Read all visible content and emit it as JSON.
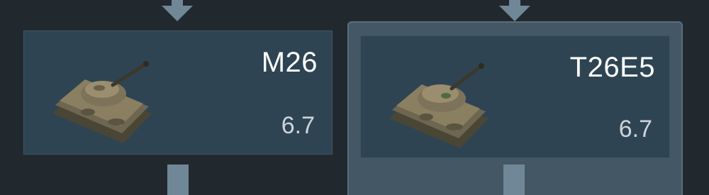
{
  "tree": {
    "vehicles": [
      {
        "name": "M26",
        "battle_rating": "6.7",
        "icon": "tank-icon",
        "selected": false
      },
      {
        "name": "T26E5",
        "battle_rating": "6.7",
        "icon": "tank-icon",
        "selected": true
      }
    ]
  },
  "colors": {
    "background": "#22292e",
    "card": "#2e4453",
    "selection": "#435765",
    "connector": "#6f8796",
    "name_text": "#ffffff",
    "br_text": "#cdd4d9"
  }
}
